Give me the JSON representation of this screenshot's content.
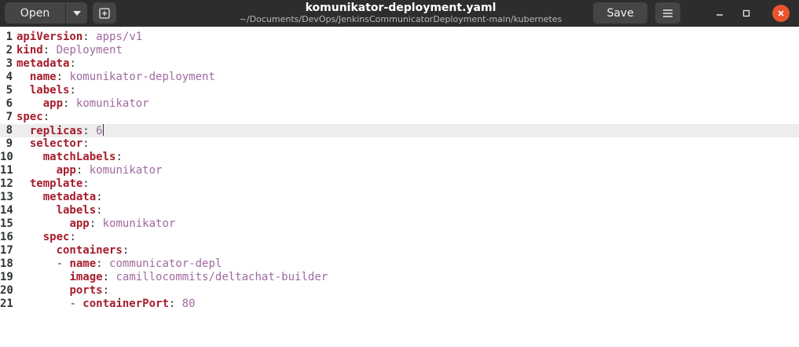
{
  "header": {
    "open_label": "Open",
    "title": "komunikator-deployment.yaml",
    "subtitle": "~/Documents/DevOps/JenkinsCommunicatorDeployment-main/kubernetes",
    "save_label": "Save",
    "icons": {
      "open_menu": "chevron-down-icon",
      "new_tab": "new-tab-icon",
      "menu": "hamburger-menu-icon",
      "minimize": "minimize-icon",
      "maximize": "maximize-icon",
      "close": "close-icon"
    }
  },
  "colors": {
    "titlebar": "#2d2d2d",
    "key": "#a51d2d",
    "value": "#a06aa0",
    "current_line": "#ededed",
    "close_button": "#e9542b"
  },
  "editor": {
    "current_line": 8,
    "lines": [
      {
        "num": "1",
        "indent": "",
        "dash": "",
        "key": "apiVersion",
        "value": "apps/v1"
      },
      {
        "num": "2",
        "indent": "",
        "dash": "",
        "key": "kind",
        "value": "Deployment"
      },
      {
        "num": "3",
        "indent": "",
        "dash": "",
        "key": "metadata",
        "value": ""
      },
      {
        "num": "4",
        "indent": "  ",
        "dash": "",
        "key": "name",
        "value": "komunikator-deployment"
      },
      {
        "num": "5",
        "indent": "  ",
        "dash": "",
        "key": "labels",
        "value": ""
      },
      {
        "num": "6",
        "indent": "    ",
        "dash": "",
        "key": "app",
        "value": "komunikator"
      },
      {
        "num": "7",
        "indent": "",
        "dash": "",
        "key": "spec",
        "value": ""
      },
      {
        "num": "8",
        "indent": "  ",
        "dash": "",
        "key": "replicas",
        "value": "6"
      },
      {
        "num": "9",
        "indent": "  ",
        "dash": "",
        "key": "selector",
        "value": ""
      },
      {
        "num": "10",
        "indent": "    ",
        "dash": "",
        "key": "matchLabels",
        "value": ""
      },
      {
        "num": "11",
        "indent": "      ",
        "dash": "",
        "key": "app",
        "value": "komunikator"
      },
      {
        "num": "12",
        "indent": "  ",
        "dash": "",
        "key": "template",
        "value": ""
      },
      {
        "num": "13",
        "indent": "    ",
        "dash": "",
        "key": "metadata",
        "value": ""
      },
      {
        "num": "14",
        "indent": "      ",
        "dash": "",
        "key": "labels",
        "value": ""
      },
      {
        "num": "15",
        "indent": "        ",
        "dash": "",
        "key": "app",
        "value": "komunikator"
      },
      {
        "num": "16",
        "indent": "    ",
        "dash": "",
        "key": "spec",
        "value": ""
      },
      {
        "num": "17",
        "indent": "      ",
        "dash": "",
        "key": "containers",
        "value": ""
      },
      {
        "num": "18",
        "indent": "      ",
        "dash": "- ",
        "key": "name",
        "value": "communicator-depl"
      },
      {
        "num": "19",
        "indent": "        ",
        "dash": "",
        "key": "image",
        "value": "camillocommits/deltachat-builder"
      },
      {
        "num": "20",
        "indent": "        ",
        "dash": "",
        "key": "ports",
        "value": ""
      },
      {
        "num": "21",
        "indent": "        ",
        "dash": "- ",
        "key": "containerPort",
        "value": "80"
      }
    ]
  }
}
